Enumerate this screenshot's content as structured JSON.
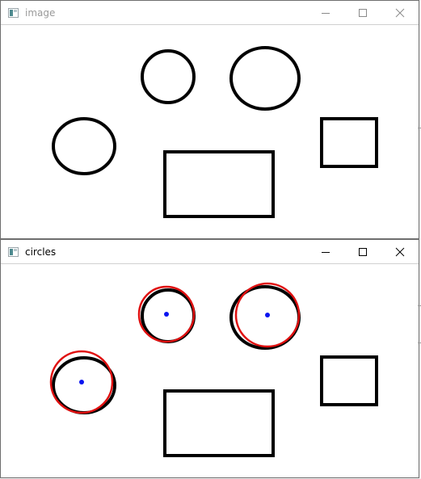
{
  "windows": {
    "image": {
      "title": "image",
      "title_color": "#9a9a9a",
      "active": false
    },
    "circles": {
      "title": "circles",
      "title_color": "#000000",
      "active": true
    }
  },
  "controls": {
    "minimize_icon": "minimize-icon",
    "maximize_icon": "maximize-icon",
    "close_icon": "close-icon"
  },
  "colors": {
    "shape_outline": "#000000",
    "detected_circle": "#e01010",
    "circle_center": "#0a14f0",
    "background": "#ffffff"
  },
  "shapes": {
    "ellipses": 3,
    "rectangles": 2,
    "detected_circles": 3
  }
}
